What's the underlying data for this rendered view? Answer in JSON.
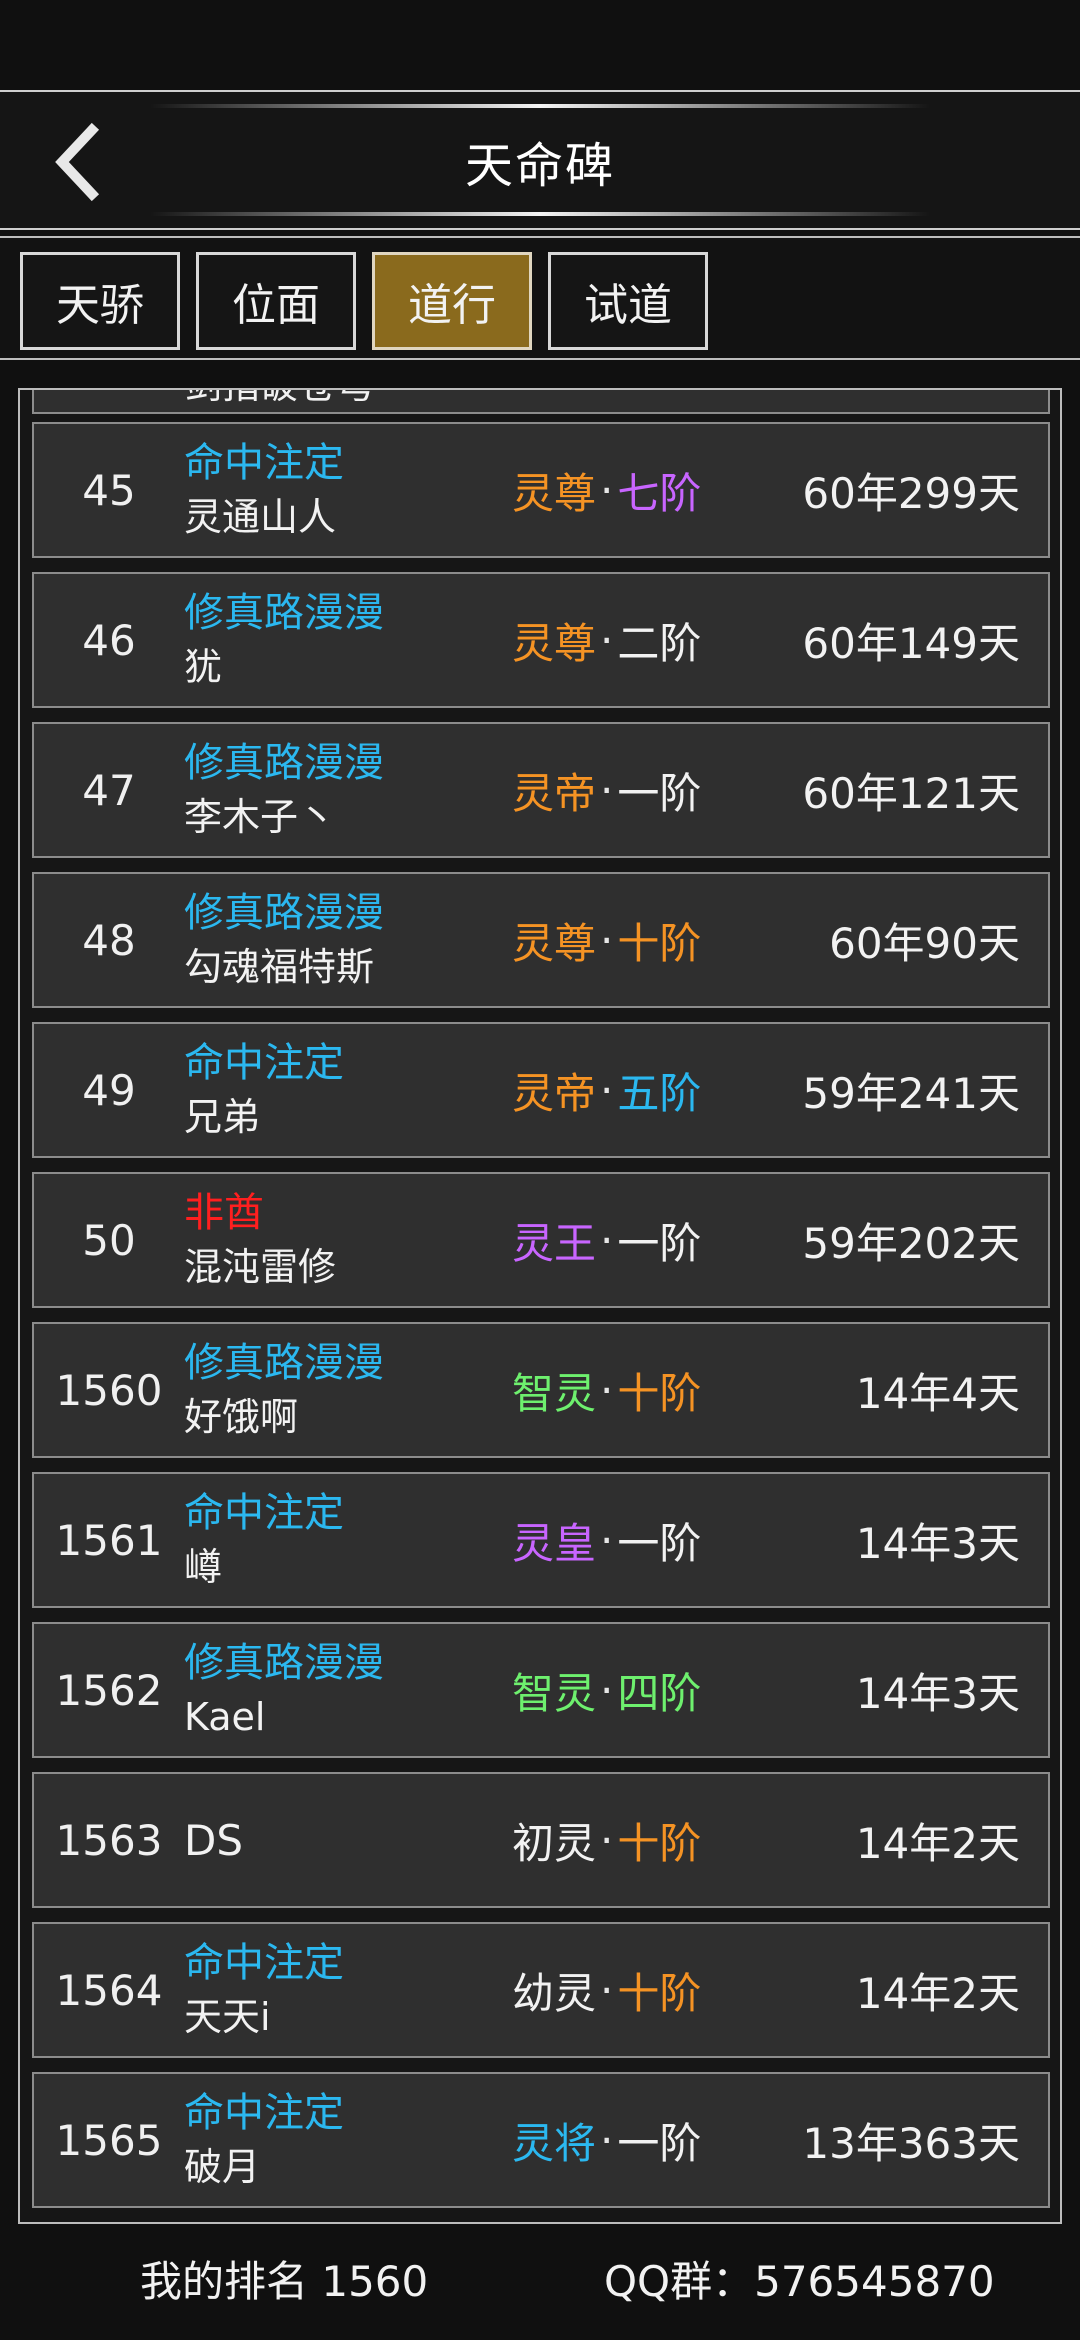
{
  "header": {
    "title": "天命碑"
  },
  "tabs": [
    {
      "label": "天骄",
      "active": false
    },
    {
      "label": "位面",
      "active": false
    },
    {
      "label": "道行",
      "active": true
    },
    {
      "label": "试道",
      "active": false
    }
  ],
  "colors": {
    "tag_blue": "#2bb8f0",
    "tag_red": "#ff1f1f",
    "orange": "#f59324",
    "purple": "#c865ff",
    "green": "#6ef06e",
    "white": "#f2f2f2",
    "active_tab": "#8a6a1d"
  },
  "list": {
    "partial_top_name": "剑指破苍穹",
    "rows": [
      {
        "rank": "45",
        "tag": "命中注定",
        "tag_color": "#2bb8f0",
        "name": "灵通山人",
        "realm": "灵尊",
        "realm_color": "#f59324",
        "stage": "七阶",
        "stage_color": "#c865ff",
        "time": "60年299天"
      },
      {
        "rank": "46",
        "tag": "修真路漫漫",
        "tag_color": "#2bb8f0",
        "name": "犹",
        "realm": "灵尊",
        "realm_color": "#f59324",
        "stage": "二阶",
        "stage_color": "#f2f2f2",
        "time": "60年149天"
      },
      {
        "rank": "47",
        "tag": "修真路漫漫",
        "tag_color": "#2bb8f0",
        "name": "李木子丶",
        "realm": "灵帝",
        "realm_color": "#f59324",
        "stage": "一阶",
        "stage_color": "#f2f2f2",
        "time": "60年121天"
      },
      {
        "rank": "48",
        "tag": "修真路漫漫",
        "tag_color": "#2bb8f0",
        "name": "勾魂福特斯",
        "realm": "灵尊",
        "realm_color": "#f59324",
        "stage": "十阶",
        "stage_color": "#f59324",
        "time": "60年90天"
      },
      {
        "rank": "49",
        "tag": "命中注定",
        "tag_color": "#2bb8f0",
        "name": "兄弟",
        "realm": "灵帝",
        "realm_color": "#f59324",
        "stage": "五阶",
        "stage_color": "#2bb8f0",
        "time": "59年241天"
      },
      {
        "rank": "50",
        "tag": "非酋",
        "tag_color": "#ff1f1f",
        "name": "混沌雷修",
        "realm": "灵王",
        "realm_color": "#c865ff",
        "stage": "一阶",
        "stage_color": "#f2f2f2",
        "time": "59年202天"
      },
      {
        "rank": "1560",
        "tag": "修真路漫漫",
        "tag_color": "#2bb8f0",
        "name": "好饿啊",
        "realm": "智灵",
        "realm_color": "#6ef06e",
        "stage": "十阶",
        "stage_color": "#f59324",
        "time": "14年4天"
      },
      {
        "rank": "1561",
        "tag": "命中注定",
        "tag_color": "#2bb8f0",
        "name": "嶟",
        "realm": "灵皇",
        "realm_color": "#c865ff",
        "stage": "一阶",
        "stage_color": "#f2f2f2",
        "time": "14年3天"
      },
      {
        "rank": "1562",
        "tag": "修真路漫漫",
        "tag_color": "#2bb8f0",
        "name": "Kael",
        "realm": "智灵",
        "realm_color": "#6ef06e",
        "stage": "四阶",
        "stage_color": "#6ef06e",
        "time": "14年3天"
      },
      {
        "rank": "1563",
        "tag": "",
        "tag_color": "#2bb8f0",
        "name": "DS",
        "realm": "初灵",
        "realm_color": "#f2f2f2",
        "stage": "十阶",
        "stage_color": "#f59324",
        "time": "14年2天"
      },
      {
        "rank": "1564",
        "tag": "命中注定",
        "tag_color": "#2bb8f0",
        "name": "天天i",
        "realm": "幼灵",
        "realm_color": "#f2f2f2",
        "stage": "十阶",
        "stage_color": "#f59324",
        "time": "14年2天"
      },
      {
        "rank": "1565",
        "tag": "命中注定",
        "tag_color": "#2bb8f0",
        "name": "破月",
        "realm": "灵将",
        "realm_color": "#2bb8f0",
        "stage": "一阶",
        "stage_color": "#f2f2f2",
        "time": "13年363天"
      }
    ]
  },
  "footer": {
    "my_rank": "我的排名 1560",
    "qq_group": "QQ群：576545870"
  }
}
